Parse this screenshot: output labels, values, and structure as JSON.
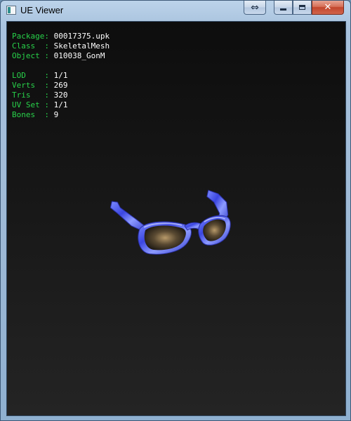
{
  "window": {
    "title": "UE Viewer",
    "buttons": {
      "swap_glyph": "⇔",
      "close_glyph": "✕"
    }
  },
  "info": {
    "package_label": "Package:",
    "package_value": "00017375.upk",
    "class_label": "Class  :",
    "class_value": "SkeletalMesh",
    "object_label": "Object :",
    "object_value": "010038_GonM",
    "lod_label": "LOD    :",
    "lod_value": "1/1",
    "verts_label": "Verts  :",
    "verts_value": "269",
    "tris_label": "Tris   :",
    "tris_value": "320",
    "uvset_label": "UV Set :",
    "uvset_value": "1/1",
    "bones_label": "Bones  :",
    "bones_value": "9"
  },
  "colors": {
    "label": "#28d24a",
    "value": "#ffffff",
    "frame_blue": "#4a5cf0"
  },
  "viewport": {
    "model": "sunglasses-mesh"
  }
}
